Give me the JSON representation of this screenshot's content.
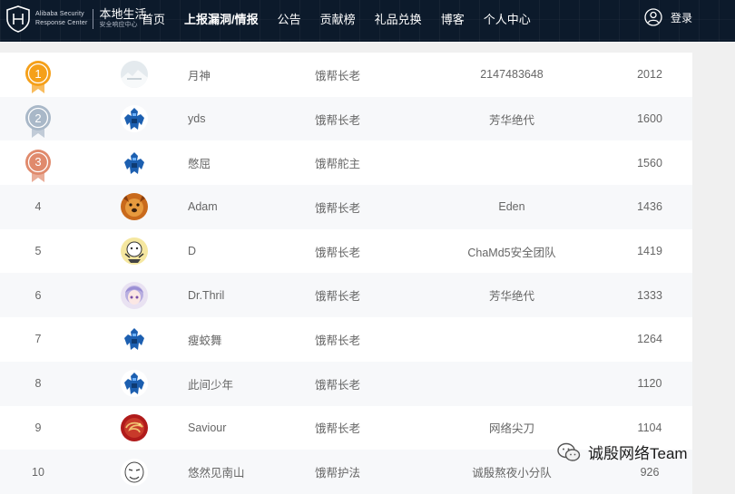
{
  "header": {
    "logo_en_line1": "Alibaba Security",
    "logo_en_line2": "Response Center",
    "logo_cn_main": "本地生活",
    "logo_cn_sub": "安全响应中心",
    "nav": [
      {
        "label": "首页",
        "active": false
      },
      {
        "label": "上报漏洞/情报",
        "active": true
      },
      {
        "label": "公告",
        "active": false
      },
      {
        "label": "贡献榜",
        "active": false
      },
      {
        "label": "礼品兑换",
        "active": false
      },
      {
        "label": "博客",
        "active": false
      },
      {
        "label": "个人中心",
        "active": false
      }
    ],
    "login_label": "登录",
    "user_icon": "user-circle-icon"
  },
  "leaderboard": {
    "rows": [
      {
        "rank": "1",
        "medal": "gold",
        "avatar": "snow-avatar",
        "name": "月神",
        "title": "饿帮长老",
        "team": "2147483648",
        "score": "2012"
      },
      {
        "rank": "2",
        "medal": "silver",
        "avatar": "robot-avatar",
        "name": "yds",
        "title": "饿帮长老",
        "team": "芳华绝代",
        "score": "1600"
      },
      {
        "rank": "3",
        "medal": "bronze",
        "avatar": "robot-avatar",
        "name": "憋屈",
        "title": "饿帮舵主",
        "team": "",
        "score": "1560"
      },
      {
        "rank": "4",
        "medal": "",
        "avatar": "dog-avatar",
        "name": "Adam",
        "title": "饿帮长老",
        "team": "Eden",
        "score": "1436"
      },
      {
        "rank": "5",
        "medal": "",
        "avatar": "cartoon-avatar",
        "name": "D",
        "title": "饿帮长老",
        "team": "ChaMd5安全团队",
        "score": "1419"
      },
      {
        "rank": "6",
        "medal": "",
        "avatar": "anime-avatar",
        "name": "Dr.Thril",
        "title": "饿帮长老",
        "team": "芳华绝代",
        "score": "1333"
      },
      {
        "rank": "7",
        "medal": "",
        "avatar": "robot-avatar",
        "name": "瘦蛟舞",
        "title": "饿帮长老",
        "team": "",
        "score": "1264"
      },
      {
        "rank": "8",
        "medal": "",
        "avatar": "robot-avatar",
        "name": "此间少年",
        "title": "饿帮长老",
        "team": "",
        "score": "1120"
      },
      {
        "rank": "9",
        "medal": "",
        "avatar": "dragon-avatar",
        "name": "Saviour",
        "title": "饿帮长老",
        "team": "网络尖刀",
        "score": "1104"
      },
      {
        "rank": "10",
        "medal": "",
        "avatar": "meme-avatar",
        "name": "悠然见南山",
        "title": "饿帮护法",
        "team": "诚殷熬夜小分队",
        "score": "926"
      }
    ]
  },
  "watermark": {
    "text": "诚殷网络Team",
    "icon": "wechat-icon"
  },
  "colors": {
    "nav_bg": "#0c1a2b",
    "gold": "#f5a01a",
    "silver": "#a9b8c8",
    "bronze": "#e08a6c",
    "robot_blue": "#1c5fb0"
  }
}
